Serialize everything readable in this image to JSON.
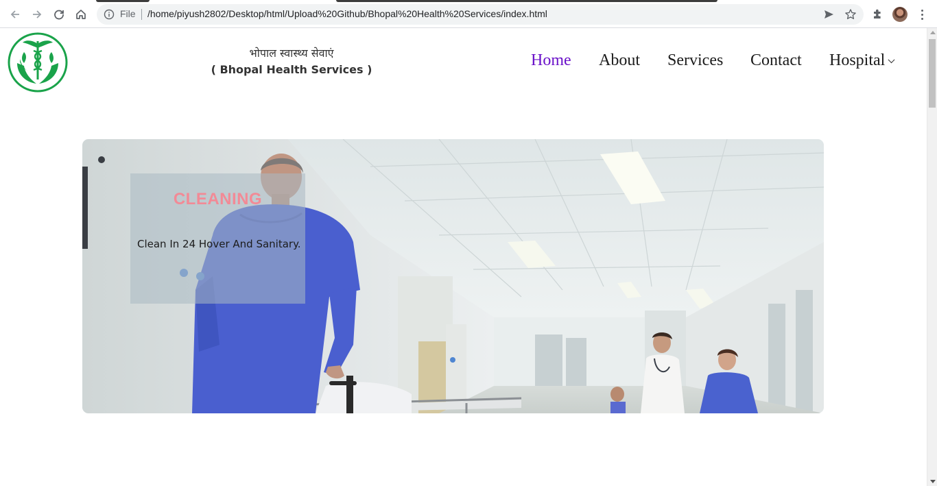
{
  "browser": {
    "omnibox_scheme_label": "File",
    "url": "/home/piyush2802/Desktop/html/Upload%20Github/Bhopal%20Health%20Services/index.html",
    "icons": [
      "back-icon",
      "forward-icon",
      "reload-icon",
      "home-icon",
      "info-icon",
      "send-icon",
      "star-icon",
      "extensions-icon",
      "profile-avatar",
      "more-icon"
    ]
  },
  "header": {
    "brand_hindi": "भोपाल स्वास्थ्य सेवाएं",
    "brand_english": "( Bhopal Health Services )",
    "logo_icon": "caduceus-hands-logo"
  },
  "nav": {
    "items": [
      {
        "label": "Home",
        "active": true
      },
      {
        "label": "About",
        "active": false
      },
      {
        "label": "Services",
        "active": false
      },
      {
        "label": "Contact",
        "active": false
      },
      {
        "label": "Hospital",
        "active": false,
        "dropdown": true
      }
    ]
  },
  "hero": {
    "title": "CLEANING",
    "text": "Clean In 24 Hover And Sanitary."
  },
  "colors": {
    "nav_active": "#6a11c9",
    "caption_title": "#f28a96",
    "logo_green": "#1aa34a",
    "scrubs_blue": "#4a5fcf"
  }
}
